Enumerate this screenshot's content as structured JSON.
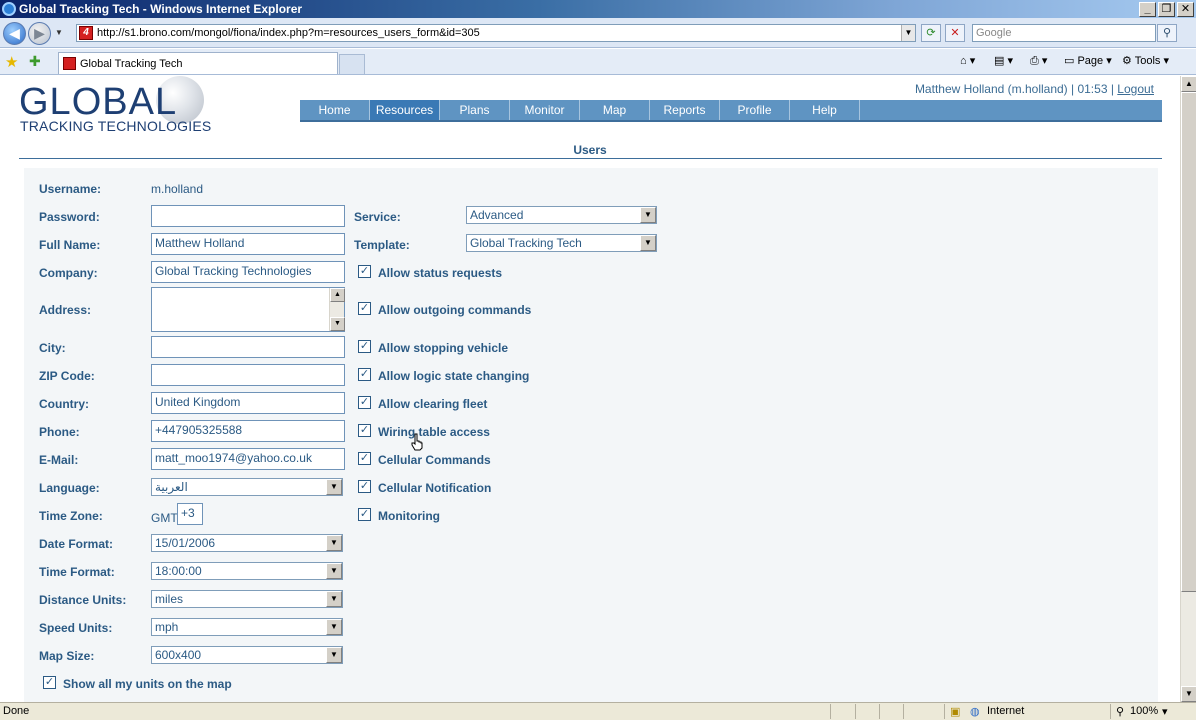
{
  "window": {
    "title": "Global Tracking Tech - Windows Internet Explorer"
  },
  "address": {
    "url": "http://s1.brono.com/mongol/fiona/index.php?m=resources_users_form&id=305",
    "search_placeholder": "Google"
  },
  "tab": {
    "title": "Global Tracking Tech"
  },
  "commands": {
    "page": "Page",
    "tools": "Tools"
  },
  "logo": {
    "main": "GLOBAL",
    "sub": "TRACKING TECHNOLOGIES"
  },
  "user": {
    "info": "Matthew Holland (m.holland) | 01:53 |",
    "logout": "Logout"
  },
  "nav": [
    "Home",
    "Resources",
    "Plans",
    "Monitor",
    "Map",
    "Reports",
    "Profile",
    "Help"
  ],
  "section_title": "Users",
  "form": {
    "username": {
      "label": "Username:",
      "value": "m.holland"
    },
    "password": {
      "label": "Password:",
      "value": ""
    },
    "fullname": {
      "label": "Full Name:",
      "value": "Matthew Holland"
    },
    "company": {
      "label": "Company:",
      "value": "Global Tracking Technologies"
    },
    "address": {
      "label": "Address:"
    },
    "city": {
      "label": "City:",
      "value": ""
    },
    "zip": {
      "label": "ZIP Code:",
      "value": ""
    },
    "country": {
      "label": "Country:",
      "value": "United Kingdom"
    },
    "phone": {
      "label": "Phone:",
      "value": "+447905325588"
    },
    "email": {
      "label": "E-Mail:",
      "value": "matt_moo1974@yahoo.co.uk"
    },
    "language": {
      "label": "Language:",
      "value": "العربية"
    },
    "timezone": {
      "label": "Time Zone:",
      "prefix": "GMT",
      "value": "+3"
    },
    "dateformat": {
      "label": "Date Format:",
      "value": "15/01/2006"
    },
    "timeformat": {
      "label": "Time Format:",
      "value": "18:00:00"
    },
    "distance": {
      "label": "Distance Units:",
      "value": "miles"
    },
    "speed": {
      "label": "Speed Units:",
      "value": "mph"
    },
    "mapsize": {
      "label": "Map Size:",
      "value": "600x400"
    },
    "showunits": {
      "label": "Show all my units on the map",
      "checked": true
    },
    "service": {
      "label": "Service:",
      "value": "Advanced"
    },
    "template": {
      "label": "Template:",
      "value": "Global Tracking Tech"
    },
    "permissions": [
      {
        "label": "Allow status requests",
        "checked": true
      },
      {
        "label": "Allow outgoing commands",
        "checked": true
      },
      {
        "label": "Allow stopping vehicle",
        "checked": true
      },
      {
        "label": "Allow logic state changing",
        "checked": true
      },
      {
        "label": "Allow clearing fleet",
        "checked": true
      },
      {
        "label": "Wiring table access",
        "checked": true
      },
      {
        "label": "Cellular Commands",
        "checked": true
      },
      {
        "label": "Cellular Notification",
        "checked": true
      },
      {
        "label": "Monitoring",
        "checked": true
      }
    ]
  },
  "status": {
    "text": "Done",
    "zone": "Internet",
    "zoom": "100%"
  }
}
